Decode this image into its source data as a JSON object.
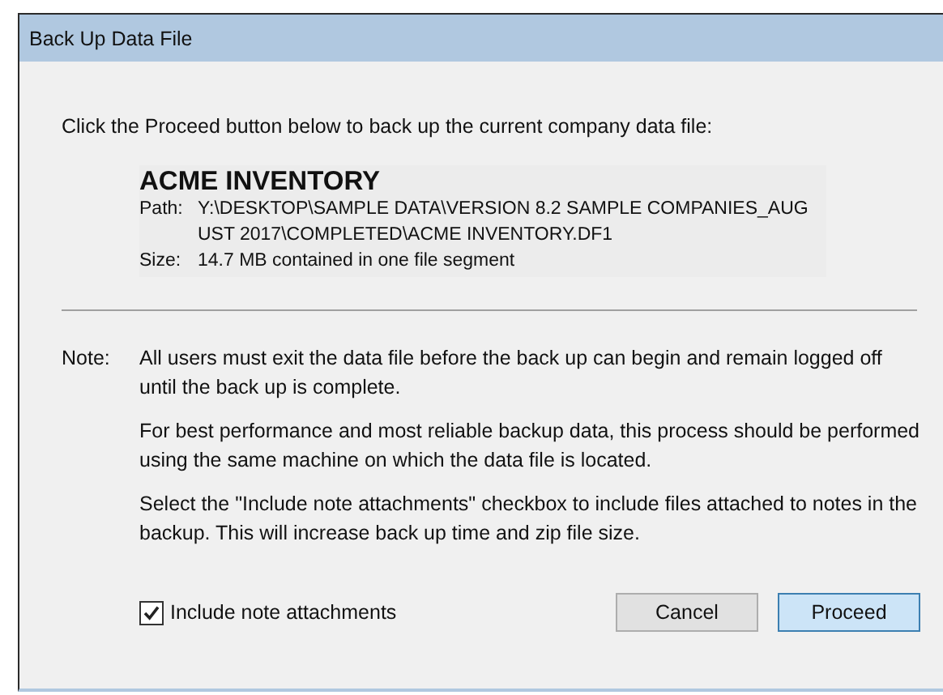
{
  "window": {
    "title": "Back Up Data File"
  },
  "intro": "Click the Proceed button below to back up the current company data file:",
  "company": {
    "name": "ACME INVENTORY",
    "path_label": "Path:",
    "path_lines": [
      "Y:\\DESKTOP\\SAMPLE DATA\\VERSION 8.2 SAMPLE COMPANIES_AUG",
      "UST 2017\\COMPLETED\\ACME INVENTORY.DF1"
    ],
    "size_label": "Size:",
    "size": "14.7 MB contained in one file segment"
  },
  "note": {
    "label": "Note:",
    "paragraphs": [
      "All users must exit the data file before the back up can begin and remain logged off until the back up is complete.",
      "For best performance and most reliable backup data, this process should be performed using the same machine on which the data file is located.",
      "Select the \"Include note attachments\" checkbox to include files attached to notes in the backup. This will increase back up time and zip file size."
    ]
  },
  "checkbox": {
    "label": "Include note attachments",
    "checked": true
  },
  "buttons": [
    {
      "label": "Cancel",
      "selected": false
    },
    {
      "label": "Proceed",
      "selected": true
    }
  ]
}
